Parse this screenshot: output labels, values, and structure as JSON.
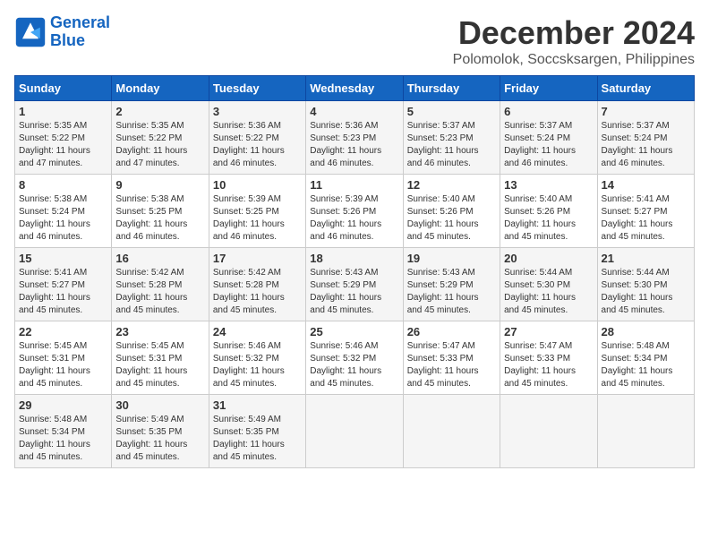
{
  "logo": {
    "line1": "General",
    "line2": "Blue"
  },
  "title": "December 2024",
  "location": "Polomolok, Soccsksargen, Philippines",
  "headers": [
    "Sunday",
    "Monday",
    "Tuesday",
    "Wednesday",
    "Thursday",
    "Friday",
    "Saturday"
  ],
  "weeks": [
    [
      {
        "day": "1",
        "sunrise": "5:35 AM",
        "sunset": "5:22 PM",
        "daylight": "11 hours and 47 minutes."
      },
      {
        "day": "2",
        "sunrise": "5:35 AM",
        "sunset": "5:22 PM",
        "daylight": "11 hours and 47 minutes."
      },
      {
        "day": "3",
        "sunrise": "5:36 AM",
        "sunset": "5:22 PM",
        "daylight": "11 hours and 46 minutes."
      },
      {
        "day": "4",
        "sunrise": "5:36 AM",
        "sunset": "5:23 PM",
        "daylight": "11 hours and 46 minutes."
      },
      {
        "day": "5",
        "sunrise": "5:37 AM",
        "sunset": "5:23 PM",
        "daylight": "11 hours and 46 minutes."
      },
      {
        "day": "6",
        "sunrise": "5:37 AM",
        "sunset": "5:24 PM",
        "daylight": "11 hours and 46 minutes."
      },
      {
        "day": "7",
        "sunrise": "5:37 AM",
        "sunset": "5:24 PM",
        "daylight": "11 hours and 46 minutes."
      }
    ],
    [
      {
        "day": "8",
        "sunrise": "5:38 AM",
        "sunset": "5:24 PM",
        "daylight": "11 hours and 46 minutes."
      },
      {
        "day": "9",
        "sunrise": "5:38 AM",
        "sunset": "5:25 PM",
        "daylight": "11 hours and 46 minutes."
      },
      {
        "day": "10",
        "sunrise": "5:39 AM",
        "sunset": "5:25 PM",
        "daylight": "11 hours and 46 minutes."
      },
      {
        "day": "11",
        "sunrise": "5:39 AM",
        "sunset": "5:26 PM",
        "daylight": "11 hours and 46 minutes."
      },
      {
        "day": "12",
        "sunrise": "5:40 AM",
        "sunset": "5:26 PM",
        "daylight": "11 hours and 45 minutes."
      },
      {
        "day": "13",
        "sunrise": "5:40 AM",
        "sunset": "5:26 PM",
        "daylight": "11 hours and 45 minutes."
      },
      {
        "day": "14",
        "sunrise": "5:41 AM",
        "sunset": "5:27 PM",
        "daylight": "11 hours and 45 minutes."
      }
    ],
    [
      {
        "day": "15",
        "sunrise": "5:41 AM",
        "sunset": "5:27 PM",
        "daylight": "11 hours and 45 minutes."
      },
      {
        "day": "16",
        "sunrise": "5:42 AM",
        "sunset": "5:28 PM",
        "daylight": "11 hours and 45 minutes."
      },
      {
        "day": "17",
        "sunrise": "5:42 AM",
        "sunset": "5:28 PM",
        "daylight": "11 hours and 45 minutes."
      },
      {
        "day": "18",
        "sunrise": "5:43 AM",
        "sunset": "5:29 PM",
        "daylight": "11 hours and 45 minutes."
      },
      {
        "day": "19",
        "sunrise": "5:43 AM",
        "sunset": "5:29 PM",
        "daylight": "11 hours and 45 minutes."
      },
      {
        "day": "20",
        "sunrise": "5:44 AM",
        "sunset": "5:30 PM",
        "daylight": "11 hours and 45 minutes."
      },
      {
        "day": "21",
        "sunrise": "5:44 AM",
        "sunset": "5:30 PM",
        "daylight": "11 hours and 45 minutes."
      }
    ],
    [
      {
        "day": "22",
        "sunrise": "5:45 AM",
        "sunset": "5:31 PM",
        "daylight": "11 hours and 45 minutes."
      },
      {
        "day": "23",
        "sunrise": "5:45 AM",
        "sunset": "5:31 PM",
        "daylight": "11 hours and 45 minutes."
      },
      {
        "day": "24",
        "sunrise": "5:46 AM",
        "sunset": "5:32 PM",
        "daylight": "11 hours and 45 minutes."
      },
      {
        "day": "25",
        "sunrise": "5:46 AM",
        "sunset": "5:32 PM",
        "daylight": "11 hours and 45 minutes."
      },
      {
        "day": "26",
        "sunrise": "5:47 AM",
        "sunset": "5:33 PM",
        "daylight": "11 hours and 45 minutes."
      },
      {
        "day": "27",
        "sunrise": "5:47 AM",
        "sunset": "5:33 PM",
        "daylight": "11 hours and 45 minutes."
      },
      {
        "day": "28",
        "sunrise": "5:48 AM",
        "sunset": "5:34 PM",
        "daylight": "11 hours and 45 minutes."
      }
    ],
    [
      {
        "day": "29",
        "sunrise": "5:48 AM",
        "sunset": "5:34 PM",
        "daylight": "11 hours and 45 minutes."
      },
      {
        "day": "30",
        "sunrise": "5:49 AM",
        "sunset": "5:35 PM",
        "daylight": "11 hours and 45 minutes."
      },
      {
        "day": "31",
        "sunrise": "5:49 AM",
        "sunset": "5:35 PM",
        "daylight": "11 hours and 45 minutes."
      },
      null,
      null,
      null,
      null
    ]
  ]
}
